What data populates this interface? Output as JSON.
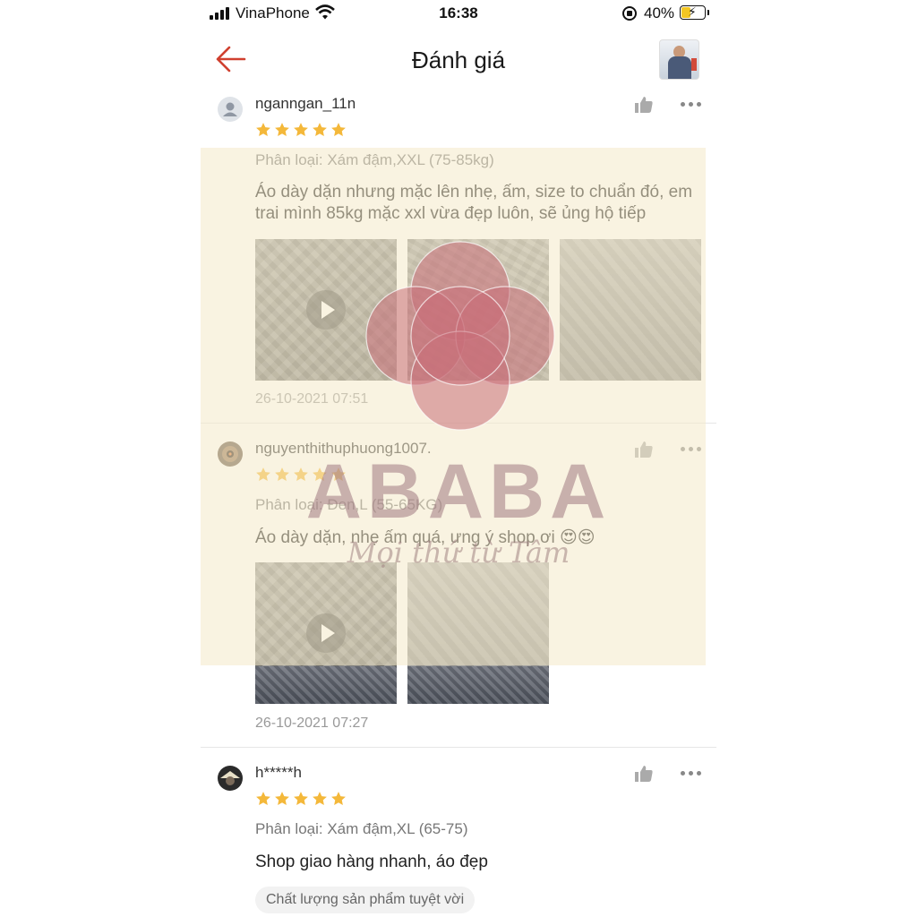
{
  "status_bar": {
    "carrier": "VinaPhone",
    "time": "16:38",
    "battery_percent": "40%",
    "battery_level": 0.4
  },
  "header": {
    "title": "Đánh giá",
    "back_icon": "arrow-left-icon",
    "accent_color": "#d0402f"
  },
  "star_color": "#f4b83a",
  "reviews": [
    {
      "username": "nganngan_11n",
      "rating": 5,
      "variant": "Phân loại: Xám đậm,XXL (75-85kg)",
      "comment": "Áo dày dặn nhưng mặc lên nhẹ, ấm, size to chuẩn đó, em trai mình 85kg mặc xxl vừa đẹp luôn, sẽ ủng hộ tiếp",
      "media": [
        "video",
        "photo",
        "photo"
      ],
      "timestamp": "26-10-2021 07:51"
    },
    {
      "username": "nguyenthithuphuong1007.",
      "rating": 5,
      "variant": "Phân loại: Đen,L (55-65KG)",
      "comment": "Áo dày dặn, nhẹ ấm quá, ưng ý shop ơi 😍😍",
      "media": [
        "video",
        "photo"
      ],
      "timestamp": "26-10-2021 07:27"
    },
    {
      "username": "h*****h",
      "rating": 5,
      "variant": "Phân loại: Xám đậm,XL (65-75)",
      "comment": "Shop giao hàng nhanh, áo đẹp",
      "tag": "Chất lượng sản phẩm tuyệt vời"
    }
  ],
  "watermark": {
    "text": "ABABA",
    "subtext": "Mọi thứ từ Tâm"
  }
}
